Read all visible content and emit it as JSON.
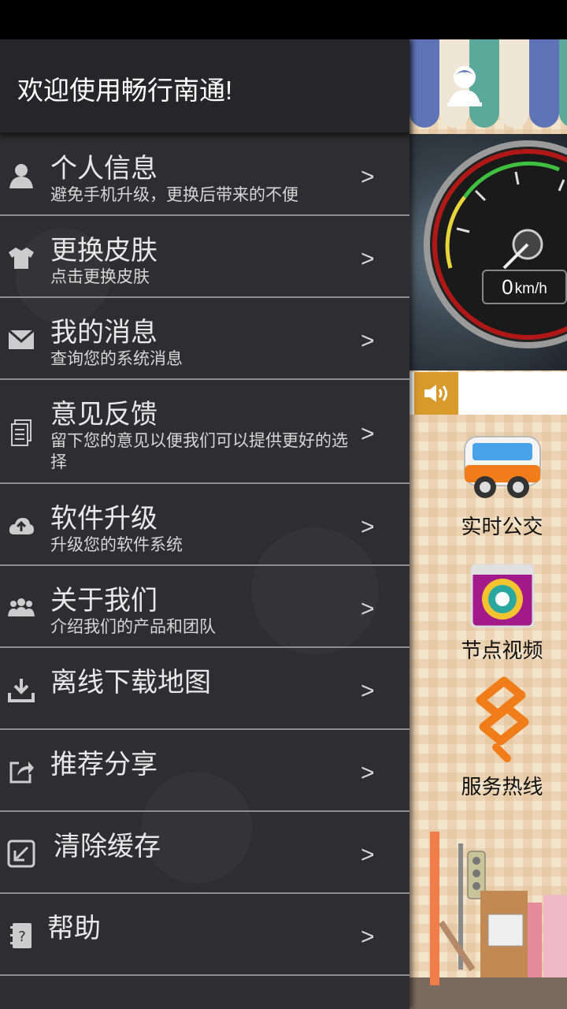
{
  "drawer": {
    "title": "欢迎使用畅行南通!",
    "items": [
      {
        "title": "个人信息",
        "subtitle": "避免手机升级，更换后带来的不便",
        "icon": "person-icon"
      },
      {
        "title": "更换皮肤",
        "subtitle": "点击更换皮肤",
        "icon": "shirt-icon"
      },
      {
        "title": "我的消息",
        "subtitle": "查询您的系统消息",
        "icon": "envelope-icon"
      },
      {
        "title": "意见反馈",
        "subtitle": "留下您的意见以便我们可以提供更好的选择",
        "icon": "document-icon"
      },
      {
        "title": "软件升级",
        "subtitle": "升级您的软件系统",
        "icon": "cloud-upload-icon"
      },
      {
        "title": "关于我们",
        "subtitle": "介绍我们的产品和团队",
        "icon": "group-icon"
      },
      {
        "title": "离线下载地图",
        "subtitle": "",
        "icon": "download-icon"
      },
      {
        "title": "推荐分享",
        "subtitle": "",
        "icon": "share-icon"
      },
      {
        "title": "清除缓存",
        "subtitle": "",
        "icon": "clear-cache-icon"
      },
      {
        "title": "帮助",
        "subtitle": "",
        "icon": "help-book-icon"
      }
    ],
    "chevron": ">"
  },
  "main": {
    "speed": {
      "value": "0",
      "unit": "km/h"
    },
    "features": [
      {
        "label": "实时公交",
        "icon": "bus-icon"
      },
      {
        "label": "节点视频",
        "icon": "camera-lens-icon"
      },
      {
        "label": "服务热线",
        "icon": "hotline-icon"
      }
    ],
    "colors": {
      "accent_orange": "#f07d1a",
      "speaker_bg": "#d99a2c",
      "drawer_bg": "#2e2e30"
    }
  }
}
